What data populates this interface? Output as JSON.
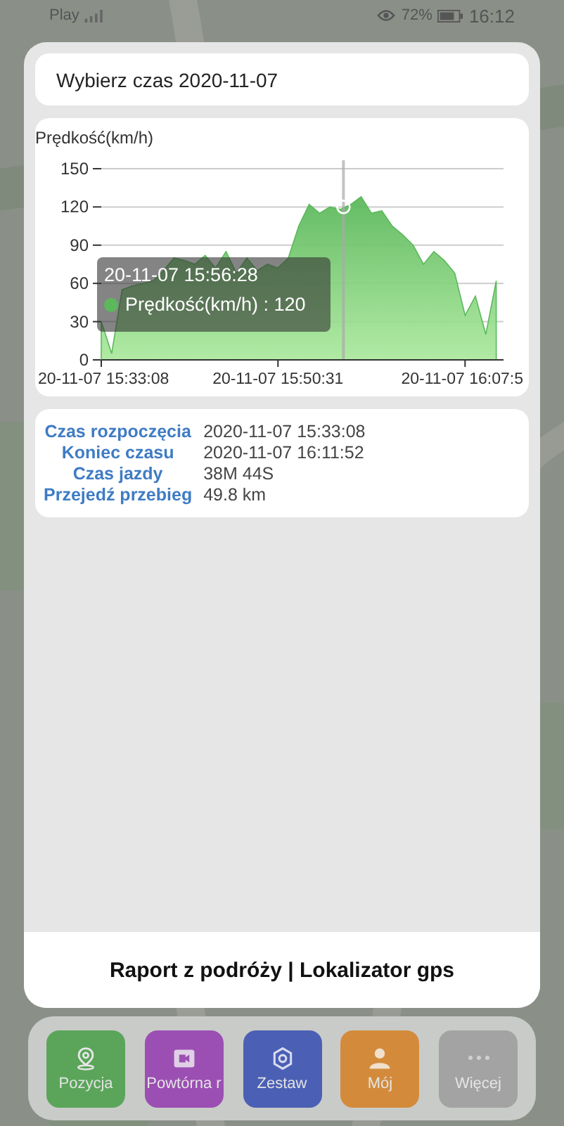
{
  "status_bar": {
    "carrier": "Play",
    "battery": "72%",
    "time": "16:12"
  },
  "date_picker": {
    "label": "Wybierz czas 2020-11-07"
  },
  "chart_panel": {
    "chart_data": {
      "type": "area",
      "ylabel": "Prędkość(km/h)",
      "categories": [
        "20-11-07 15:33:08",
        null,
        null,
        null,
        null,
        null,
        null,
        null,
        null,
        null,
        null,
        null,
        null,
        null,
        null,
        null,
        null,
        "20-11-07 15:50:31",
        null,
        null,
        null,
        null,
        null,
        null,
        null,
        null,
        null,
        null,
        null,
        null,
        null,
        null,
        null,
        null,
        null,
        "20-11-07 16:07:5",
        null,
        null,
        null
      ],
      "series": [
        {
          "name": "Prędkość(km/h)",
          "color": "#5cb85c",
          "values": [
            30,
            5,
            55,
            58,
            60,
            62,
            70,
            80,
            78,
            75,
            82,
            72,
            85,
            68,
            80,
            70,
            75,
            72,
            80,
            105,
            122,
            115,
            120,
            118,
            122,
            128,
            115,
            117,
            105,
            98,
            90,
            75,
            85,
            78,
            68,
            35,
            50,
            20,
            62
          ]
        }
      ],
      "ylim": [
        0,
        150
      ],
      "grid": true,
      "yticks": [
        0,
        30,
        60,
        90,
        120,
        150
      ]
    },
    "tooltip": {
      "title": "20-11-07 15:56:28",
      "value": ": 120"
    }
  },
  "details": [
    {
      "label": "Czas rozpoczęcia",
      "value": "2020-11-07 15:33:08"
    },
    {
      "label": "Koniec czasu",
      "value": "2020-11-07 16:11:52"
    },
    {
      "label": "Czas jazdy",
      "value": "38M 44S"
    },
    {
      "label": "Przejedź przebieg",
      "value": "49.8 km"
    }
  ],
  "footer": {
    "title": "Raport z podróży | Lokalizator gps"
  },
  "nav": [
    {
      "label": "Pozycja",
      "kind": "pin",
      "color": "#5aa55a"
    },
    {
      "label": "Powtórna r",
      "kind": "camera",
      "color": "#9b4fb3"
    },
    {
      "label": "Zestaw",
      "kind": "gear",
      "color": "#4b5fb5"
    },
    {
      "label": "Mój",
      "kind": "person",
      "color": "#d38b3b"
    },
    {
      "label": "Więcej",
      "kind": "dots",
      "color": "#a3a3a3"
    }
  ]
}
